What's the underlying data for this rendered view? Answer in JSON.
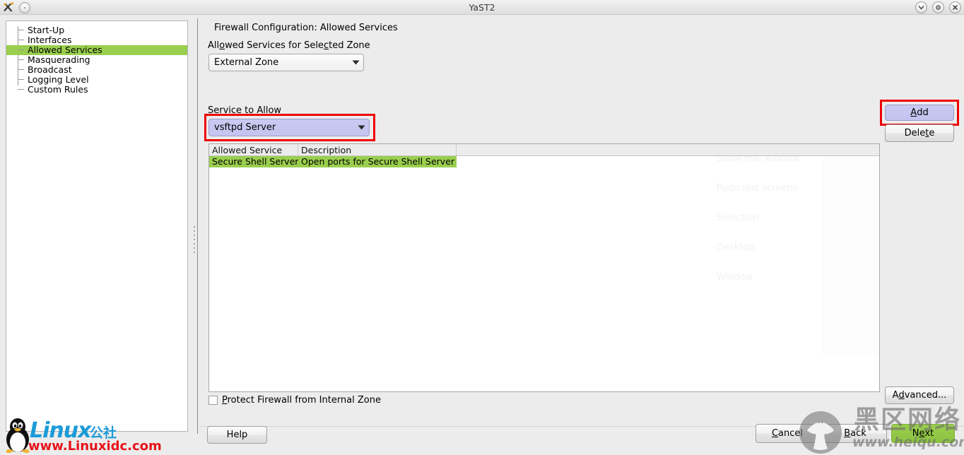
{
  "window": {
    "title": "YaST2",
    "app_icon": "yast-tools-icon",
    "menu_button_icon": "window-menu-icon",
    "controls": [
      {
        "name": "minimize-button",
        "icon": "chevron-down-icon"
      },
      {
        "name": "maximize-button",
        "icon": "circle-dot-icon"
      },
      {
        "name": "close-button",
        "icon": "close-x-icon"
      }
    ]
  },
  "sidebar": {
    "items": [
      {
        "label": "Start-Up",
        "selected": false
      },
      {
        "label": "Interfaces",
        "selected": false
      },
      {
        "label": "Allowed Services",
        "selected": true
      },
      {
        "label": "Masquerading",
        "selected": false
      },
      {
        "label": "Broadcast",
        "selected": false
      },
      {
        "label": "Logging Level",
        "selected": false
      },
      {
        "label": "Custom Rules",
        "selected": false
      }
    ],
    "selected_color": "#9ace4e"
  },
  "main": {
    "heading": "Firewall Configuration: Allowed Services",
    "zone_label_pre": "All",
    "zone_label_mnemonic": "o",
    "zone_label_mid": "wed Services for Sele",
    "zone_label_mnemonic2": "c",
    "zone_label_post": "ted Zone",
    "zone_label_full": "Allowed Services for Selected Zone",
    "zone_value": "External Zone",
    "service_label": "Service to Allow",
    "service_value": "vsftpd Server",
    "service_highlight_color": "#c5c6f0",
    "annotation_color": "#ee0000",
    "table": {
      "columns": [
        "Allowed Service",
        "Description"
      ],
      "rows": [
        {
          "service": "Secure Shell Server",
          "description": "Open ports for Secure Shell Server",
          "selected": true
        }
      ],
      "selected_color": "#9ace4e"
    },
    "ghost_menu": [
      "Show mai window",
      "Redo last screens",
      "Selection",
      "Desktop",
      "Window"
    ],
    "checkbox": {
      "label_pre": "",
      "label_mnemonic": "P",
      "label_post": "rotect Firewall from Internal Zone",
      "label_full": "Protect Firewall from Internal Zone",
      "checked": false
    }
  },
  "buttons": {
    "add": {
      "pre": "",
      "mnemonic": "A",
      "post": "dd",
      "full": "Add",
      "highlighted": true
    },
    "delete": {
      "pre": "Dele",
      "mnemonic": "t",
      "post": "e",
      "full": "Delete"
    },
    "advanced": {
      "pre": "A",
      "mnemonic": "d",
      "post": "vanced...",
      "full": "Advanced..."
    },
    "help": {
      "pre": "Help",
      "mnemonic": "",
      "post": "",
      "full": "Help"
    },
    "cancel": {
      "pre": "",
      "mnemonic": "C",
      "post": "ancel",
      "full": "Cancel"
    },
    "back": {
      "pre": "",
      "mnemonic": "B",
      "post": "ack",
      "full": "Back"
    },
    "next": {
      "pre": "N",
      "mnemonic": "e",
      "post": "xt",
      "full": "Next",
      "color": "#9ace4e"
    }
  },
  "watermarks": {
    "linux": {
      "brand": "Linux",
      "cn": "公社",
      "url": "www.Linuxidc.com",
      "brand_color": "#1b9bd8",
      "url_color": "#e8121a",
      "icon": "tux-penguin-icon"
    },
    "heiqu": {
      "cn": "黑区网络",
      "url": "www.heiqu.com",
      "icon": "mushroom-icon"
    }
  }
}
